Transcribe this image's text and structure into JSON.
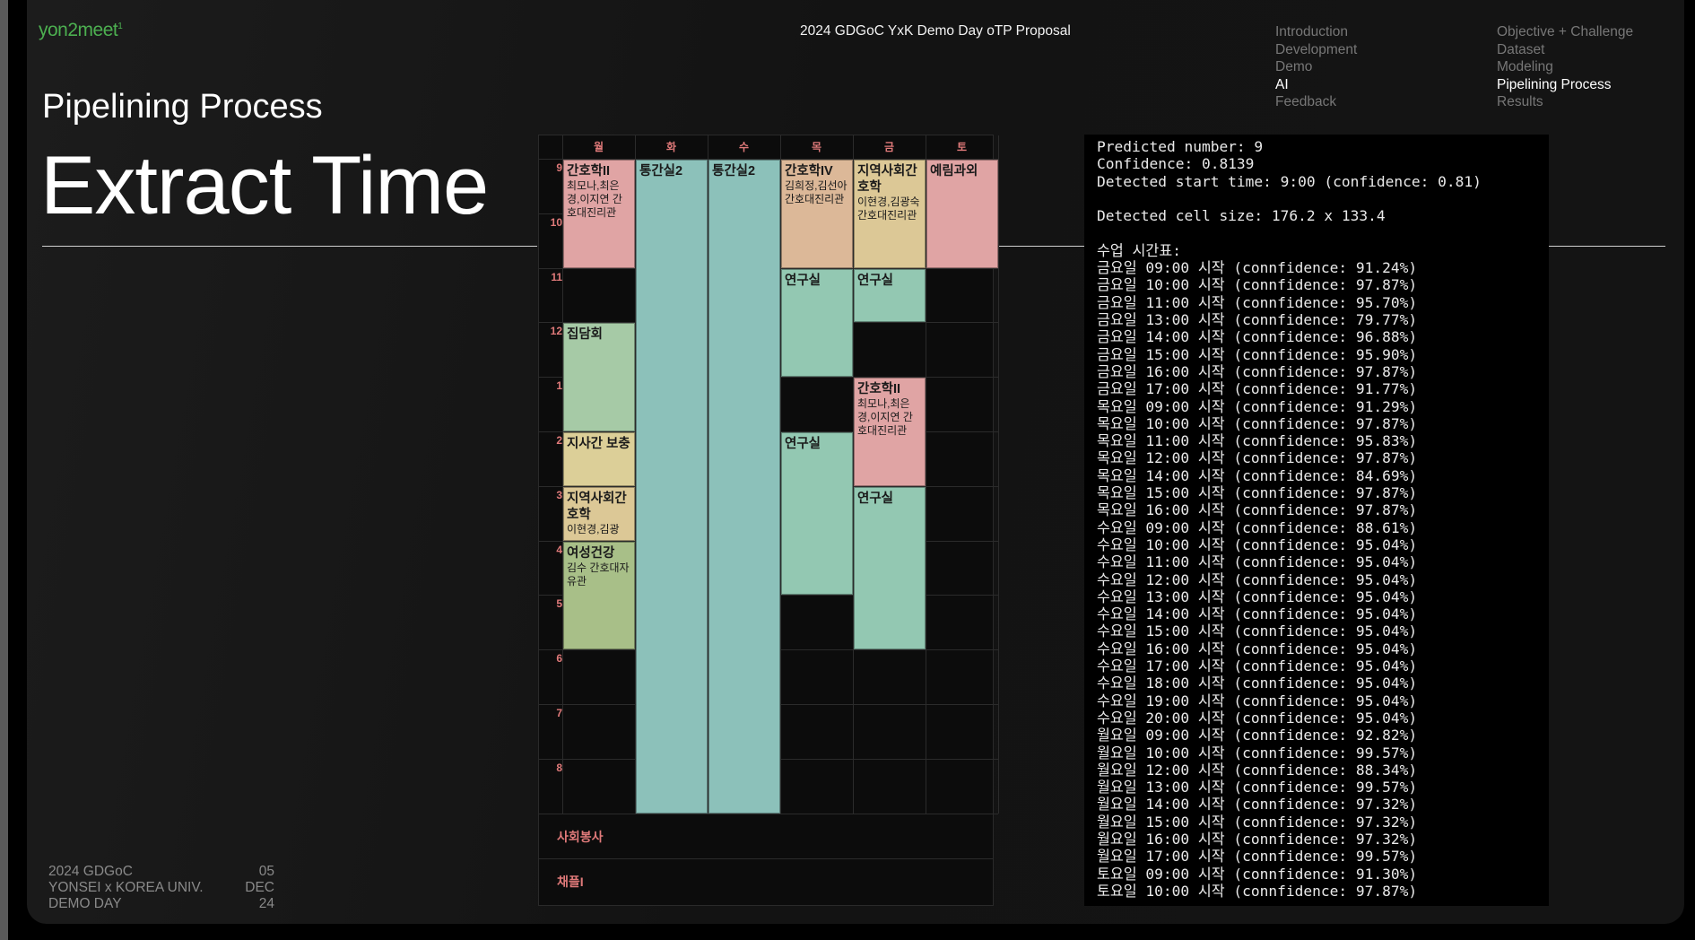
{
  "logo": "yon2meet",
  "logo_sup": "1",
  "header_title": "2024 GDGoC YxK Demo Day oTP Proposal",
  "nav_left": [
    "Introduction",
    "Development",
    "Demo",
    "AI",
    "Feedback"
  ],
  "nav_right": [
    "Objective + Challenge",
    "Dataset",
    "Modeling",
    "Pipelining Process",
    "Results"
  ],
  "active_nav": [
    "AI",
    "Pipelining Process"
  ],
  "subtitle": "Pipelining Process",
  "title": "Extract Time",
  "footer_left": [
    "2024 GDGoC",
    "YONSEI x KOREA UNIV.",
    "DEMO DAY"
  ],
  "footer_right": [
    "05",
    "DEC",
    "24"
  ],
  "timetable": {
    "days": [
      "월",
      "화",
      "수",
      "목",
      "금",
      "토"
    ],
    "hours": [
      "9",
      "10",
      "11",
      "12",
      "1",
      "2",
      "3",
      "4",
      "5",
      "6",
      "7",
      "8"
    ],
    "blocks": [
      {
        "day": 0,
        "start": 0,
        "dur": 2,
        "color": "pink",
        "title": "간호학II",
        "sub": "최모나,최은경,이지연 간호대진리관"
      },
      {
        "day": 1,
        "start": 0,
        "dur": 12,
        "color": "teal",
        "title": "통간실2",
        "sub": ""
      },
      {
        "day": 2,
        "start": 0,
        "dur": 12,
        "color": "teal",
        "title": "통간실2",
        "sub": ""
      },
      {
        "day": 3,
        "start": 0,
        "dur": 2,
        "color": "tan",
        "title": "간호학IV",
        "sub": "김희정,김선아 간호대진리관"
      },
      {
        "day": 4,
        "start": 0,
        "dur": 2,
        "color": "beige",
        "title": "지역사회간호학",
        "sub": "이현경,김광숙 간호대진리관"
      },
      {
        "day": 5,
        "start": 0,
        "dur": 2,
        "color": "pink",
        "title": "예림과외",
        "sub": ""
      },
      {
        "day": 3,
        "start": 2,
        "dur": 2,
        "color": "mint",
        "title": "연구실",
        "sub": ""
      },
      {
        "day": 4,
        "start": 2,
        "dur": 1,
        "color": "mint",
        "title": "연구실",
        "sub": ""
      },
      {
        "day": 0,
        "start": 3,
        "dur": 2,
        "color": "lightgreen",
        "title": "집담회",
        "sub": ""
      },
      {
        "day": 4,
        "start": 4,
        "dur": 2,
        "color": "pink",
        "title": "간호학II",
        "sub": "최모나,최은경,이지연 간호대진리관"
      },
      {
        "day": 0,
        "start": 5,
        "dur": 1,
        "color": "yell",
        "title": "지사간 보충",
        "sub": ""
      },
      {
        "day": 3,
        "start": 5,
        "dur": 3,
        "color": "mint",
        "title": "연구실",
        "sub": ""
      },
      {
        "day": 0,
        "start": 6,
        "dur": 1,
        "color": "beige",
        "title": "지역사회간호학",
        "sub": "이현경,김광"
      },
      {
        "day": 4,
        "start": 6,
        "dur": 3,
        "color": "mint",
        "title": "연구실",
        "sub": ""
      },
      {
        "day": 0,
        "start": 7,
        "dur": 2,
        "color": "green",
        "title": "여성건강",
        "sub": "김수 간호대자유관"
      }
    ],
    "extras": [
      "사회봉사",
      "채플I"
    ]
  },
  "console_lines": [
    "Predicted number: 9",
    "Confidence: 0.8139",
    "Detected start time: 9:00 (confidence: 0.81)",
    "",
    "Detected cell size: 176.2 x 133.4",
    "",
    "수업 시간표:",
    "금요일 09:00 시작 (connfidence: 91.24%)",
    "금요일 10:00 시작 (connfidence: 97.87%)",
    "금요일 11:00 시작 (connfidence: 95.70%)",
    "금요일 13:00 시작 (connfidence: 79.77%)",
    "금요일 14:00 시작 (connfidence: 96.88%)",
    "금요일 15:00 시작 (connfidence: 95.90%)",
    "금요일 16:00 시작 (connfidence: 97.87%)",
    "금요일 17:00 시작 (connfidence: 91.77%)",
    "목요일 09:00 시작 (connfidence: 91.29%)",
    "목요일 10:00 시작 (connfidence: 97.87%)",
    "목요일 11:00 시작 (connfidence: 95.83%)",
    "목요일 12:00 시작 (connfidence: 97.87%)",
    "목요일 14:00 시작 (connfidence: 84.69%)",
    "목요일 15:00 시작 (connfidence: 97.87%)",
    "목요일 16:00 시작 (connfidence: 97.87%)",
    "수요일 09:00 시작 (connfidence: 88.61%)",
    "수요일 10:00 시작 (connfidence: 95.04%)",
    "수요일 11:00 시작 (connfidence: 95.04%)",
    "수요일 12:00 시작 (connfidence: 95.04%)",
    "수요일 13:00 시작 (connfidence: 95.04%)",
    "수요일 14:00 시작 (connfidence: 95.04%)",
    "수요일 15:00 시작 (connfidence: 95.04%)",
    "수요일 16:00 시작 (connfidence: 95.04%)",
    "수요일 17:00 시작 (connfidence: 95.04%)",
    "수요일 18:00 시작 (connfidence: 95.04%)",
    "수요일 19:00 시작 (connfidence: 95.04%)",
    "수요일 20:00 시작 (connfidence: 95.04%)",
    "월요일 09:00 시작 (connfidence: 92.82%)",
    "월요일 10:00 시작 (connfidence: 99.57%)",
    "월요일 12:00 시작 (connfidence: 88.34%)",
    "월요일 13:00 시작 (connfidence: 99.57%)",
    "월요일 14:00 시작 (connfidence: 97.32%)",
    "월요일 15:00 시작 (connfidence: 97.32%)",
    "월요일 16:00 시작 (connfidence: 97.32%)",
    "월요일 17:00 시작 (connfidence: 99.57%)",
    "토요일 09:00 시작 (connfidence: 91.30%)",
    "토요일 10:00 시작 (connfidence: 97.87%)"
  ]
}
